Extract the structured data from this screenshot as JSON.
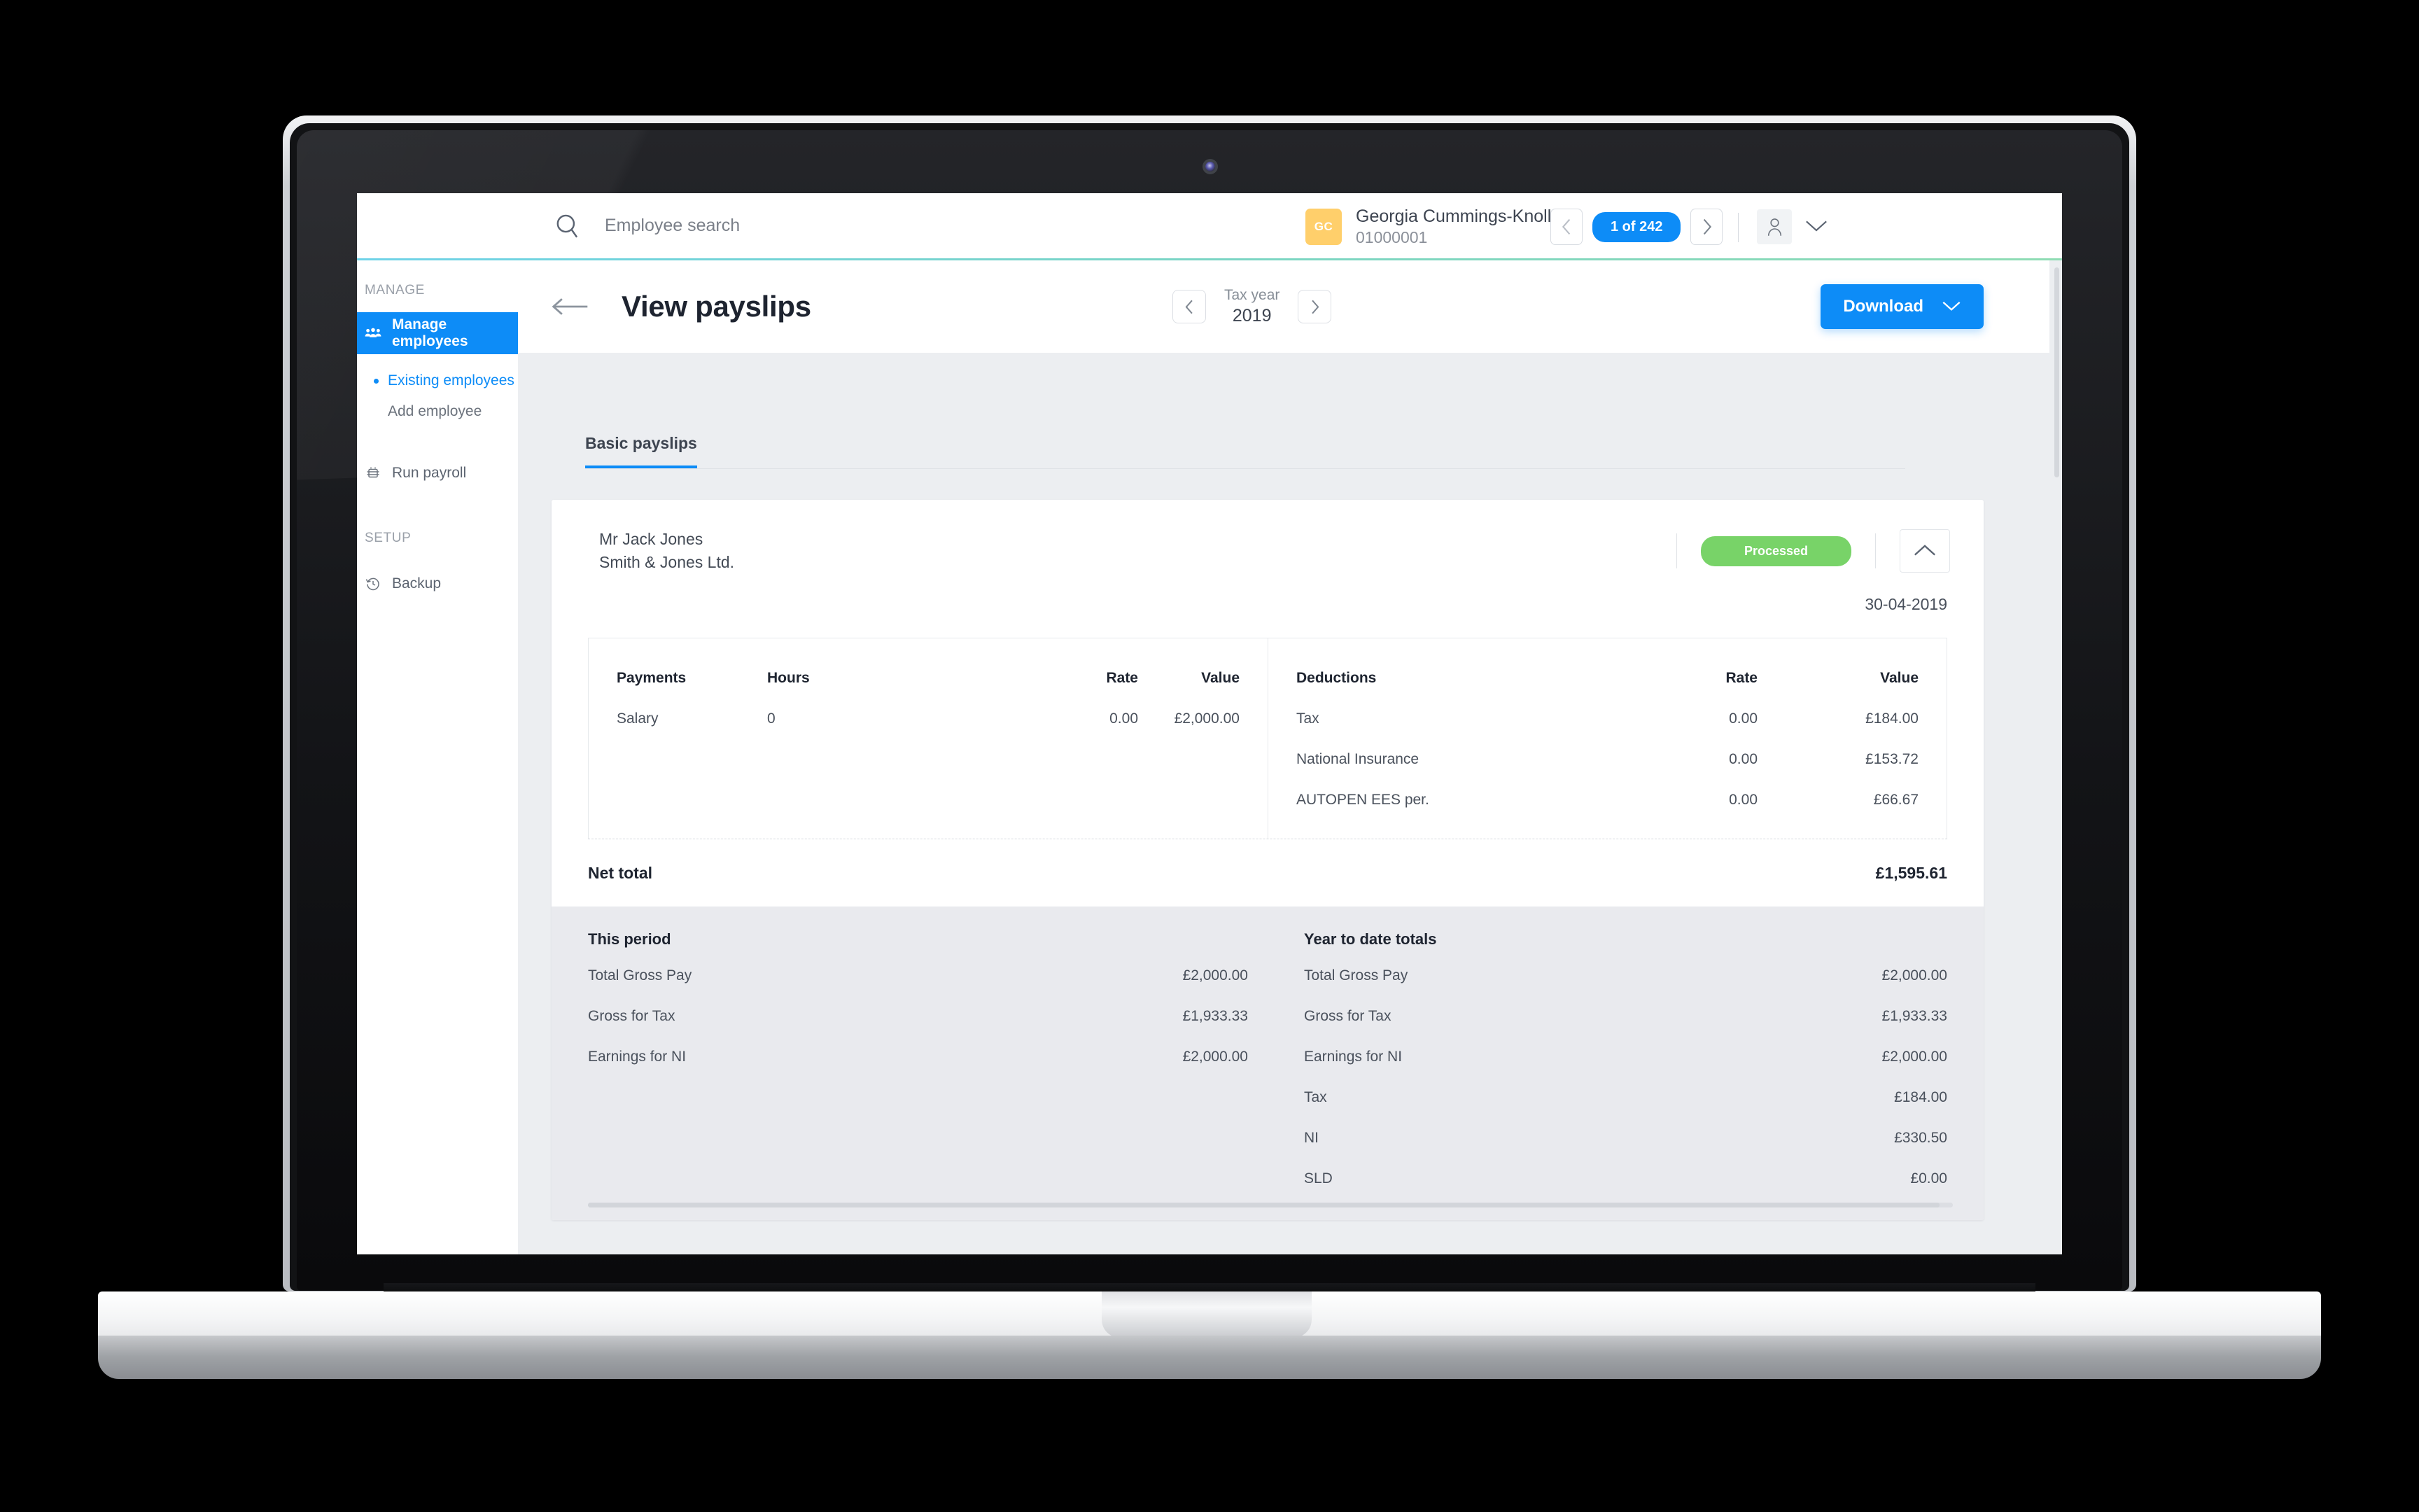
{
  "topbar": {
    "search_placeholder": "Employee search",
    "search_value": "",
    "search_icon": "search-icon",
    "user_initials": "GC",
    "user_name": "Georgia Cummings-Knoll",
    "user_id": "01000001",
    "pager_prev_icon": "chevron-left-icon",
    "pager_label": "1 of 242",
    "pager_next_icon": "chevron-right-icon",
    "account_icon": "user-icon",
    "account_caret_icon": "chevron-down-icon"
  },
  "sidebar": {
    "group_manage": "MANAGE",
    "group_setup": "SETUP",
    "items": [
      {
        "label": "Manage employees",
        "icon": "people-icon",
        "active": true
      },
      {
        "label": "Existing employees",
        "icon": "bullet-icon",
        "current": true
      },
      {
        "label": "Add employee",
        "icon": "bullet-icon",
        "current": false
      },
      {
        "label": "Run payroll",
        "icon": "payroll-icon",
        "active": false
      },
      {
        "label": "Backup",
        "icon": "history-icon",
        "active": false
      }
    ]
  },
  "page": {
    "back_icon": "arrow-left-icon",
    "title": "View payslips",
    "tax_year_label": "Tax year",
    "tax_year_value": "2019",
    "tax_prev_icon": "chevron-left-icon",
    "tax_next_icon": "chevron-right-icon",
    "download_label": "Download",
    "download_caret_icon": "chevron-down-icon",
    "tab_label": "Basic payslips"
  },
  "payslip": {
    "employee_name": "Mr Jack Jones",
    "company": "Smith & Jones Ltd.",
    "status": "Processed",
    "status_color": "#78d368",
    "collapse_icon": "chevron-up-icon",
    "date": "30-04-2019",
    "payments": {
      "headers": [
        "Payments",
        "Hours",
        "Rate",
        "Value"
      ],
      "rows": [
        {
          "name": "Salary",
          "hours": "0",
          "rate": "0.00",
          "value": "£2,000.00"
        }
      ]
    },
    "deductions": {
      "headers": [
        "Deductions",
        "Rate",
        "Value"
      ],
      "rows": [
        {
          "name": "Tax",
          "rate": "0.00",
          "value": "£184.00"
        },
        {
          "name": "National Insurance",
          "rate": "0.00",
          "value": "£153.72"
        },
        {
          "name": "AUTOPEN EES per.",
          "rate": "0.00",
          "value": "£66.67"
        }
      ]
    },
    "net_total_label": "Net total",
    "net_total_value": "£1,595.61",
    "this_period": {
      "title": "This period",
      "rows": [
        {
          "label": "Total Gross Pay",
          "value": "£2,000.00"
        },
        {
          "label": "Gross for Tax",
          "value": "£1,933.33"
        },
        {
          "label": "Earnings for NI",
          "value": "£2,000.00"
        }
      ]
    },
    "year_to_date": {
      "title": "Year to date totals",
      "rows": [
        {
          "label": "Total Gross Pay",
          "value": "£2,000.00"
        },
        {
          "label": "Gross for Tax",
          "value": "£1,933.33"
        },
        {
          "label": "Earnings for NI",
          "value": "£2,000.00"
        },
        {
          "label": "Tax",
          "value": "£184.00"
        },
        {
          "label": "NI",
          "value": "£330.50"
        },
        {
          "label": "SLD",
          "value": "£0.00"
        }
      ]
    }
  },
  "colors": {
    "accent": "#0d8cf7",
    "status_green": "#78d368",
    "avatar_yellow": "#ffcf6b",
    "page_bg": "#eceef1",
    "totals_bg": "#e9eaee"
  }
}
